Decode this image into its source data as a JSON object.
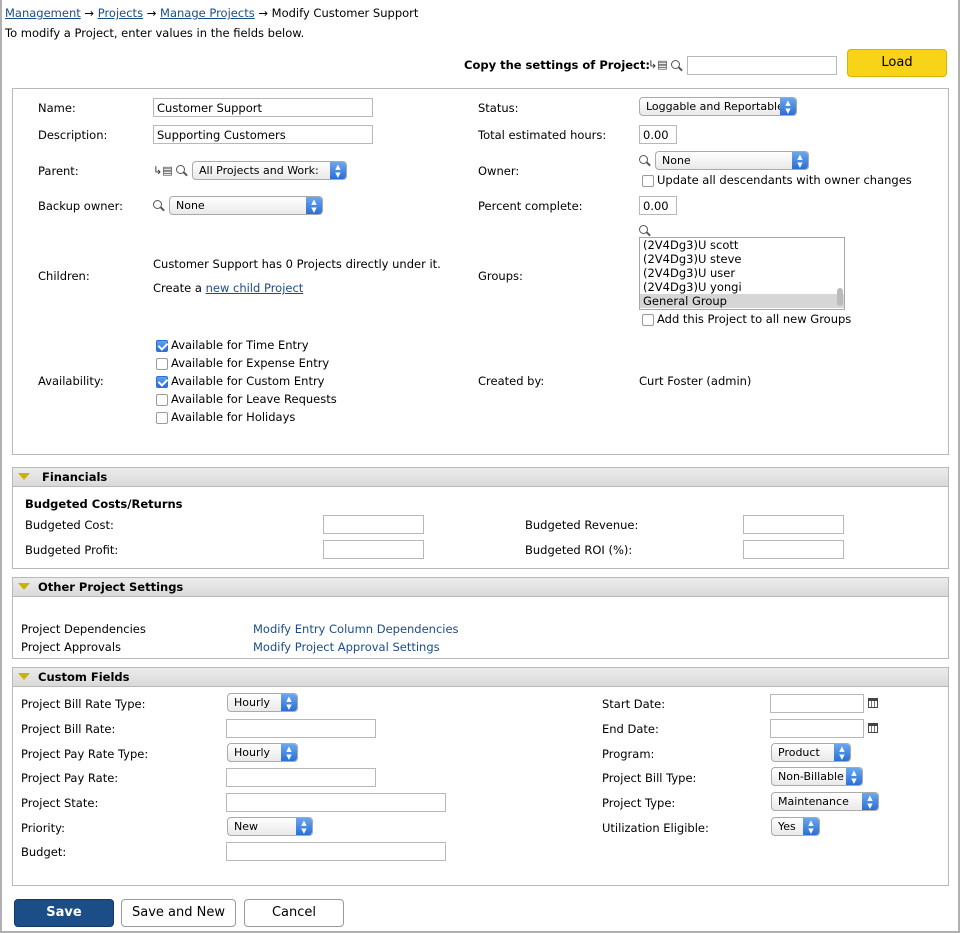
{
  "breadcrumb": {
    "items": [
      "Management",
      "Projects",
      "Manage Projects"
    ],
    "sep": "→",
    "current": "Modify Customer Support"
  },
  "intro": "To modify a Project, enter values in the fields below.",
  "copy": {
    "label": "Copy the settings of Project:",
    "value": "",
    "load": "Load"
  },
  "details": {
    "name_label": "Name:",
    "name": "Customer Support",
    "desc_label": "Description:",
    "desc": "Supporting Customers",
    "parent_label": "Parent:",
    "parent": "All Projects and Work:",
    "backup_label": "Backup owner:",
    "backup": "None",
    "children_label": "Children:",
    "children_text": "Customer Support has 0 Projects directly under it.",
    "create_prefix": "Create a",
    "create_link": "new child Project",
    "availability_label": "Availability:",
    "availability": [
      {
        "label": "Available for Time Entry",
        "checked": true
      },
      {
        "label": "Available for Expense Entry",
        "checked": false
      },
      {
        "label": "Available for Custom Entry",
        "checked": true
      },
      {
        "label": "Available for Leave Requests",
        "checked": false
      },
      {
        "label": "Available for Holidays",
        "checked": false
      }
    ],
    "status_label": "Status:",
    "status": "Loggable and Reportable",
    "hours_label": "Total estimated hours:",
    "hours": "0.00",
    "owner_label": "Owner:",
    "owner": "None",
    "owner_update": "Update all descendants with owner changes",
    "percent_label": "Percent complete:",
    "percent": "0.00",
    "groups_label": "Groups:",
    "groups": [
      "(2V4Dg3)U scott",
      "(2V4Dg3)U steve",
      "(2V4Dg3)U user",
      "(2V4Dg3)U yongi",
      "General Group"
    ],
    "groups_add": "Add this Project to all new Groups",
    "created_label": "Created by:",
    "created": "Curt Foster (admin)"
  },
  "financials": {
    "title": "Financials",
    "subtitle": "Budgeted Costs/Returns",
    "cost_label": "Budgeted Cost:",
    "cost": "",
    "profit_label": "Budgeted Profit:",
    "profit": "",
    "revenue_label": "Budgeted Revenue:",
    "revenue": "",
    "roi_label": "Budgeted ROI (%):",
    "roi": ""
  },
  "other": {
    "title": "Other Project Settings",
    "dep_label": "Project Dependencies",
    "dep_link": "Modify Entry Column Dependencies",
    "appr_label": "Project Approvals",
    "appr_link": "Modify Project Approval Settings"
  },
  "custom": {
    "title": "Custom Fields",
    "bill_rate_type_label": "Project Bill Rate Type:",
    "bill_rate_type": "Hourly",
    "bill_rate_label": "Project Bill Rate:",
    "bill_rate": "",
    "pay_rate_type_label": "Project Pay Rate Type:",
    "pay_rate_type": "Hourly",
    "pay_rate_label": "Project Pay Rate:",
    "pay_rate": "",
    "state_label": "Project State:",
    "state": "",
    "priority_label": "Priority:",
    "priority": "New",
    "budget_label": "Budget:",
    "budget": "",
    "start_label": "Start Date:",
    "start": "",
    "end_label": "End Date:",
    "end": "",
    "program_label": "Program:",
    "program": "Product",
    "bill_type_label": "Project Bill Type:",
    "bill_type": "Non-Billable",
    "type_label": "Project Type:",
    "type": "Maintenance",
    "util_label": "Utilization Eligible:",
    "util": "Yes"
  },
  "buttons": {
    "save": "Save",
    "save_new": "Save and New",
    "cancel": "Cancel"
  },
  "colors": {
    "load": "#f7d417",
    "save": "#1b4d86",
    "link": "#1a4e8a",
    "section": "#d9d9d9"
  }
}
